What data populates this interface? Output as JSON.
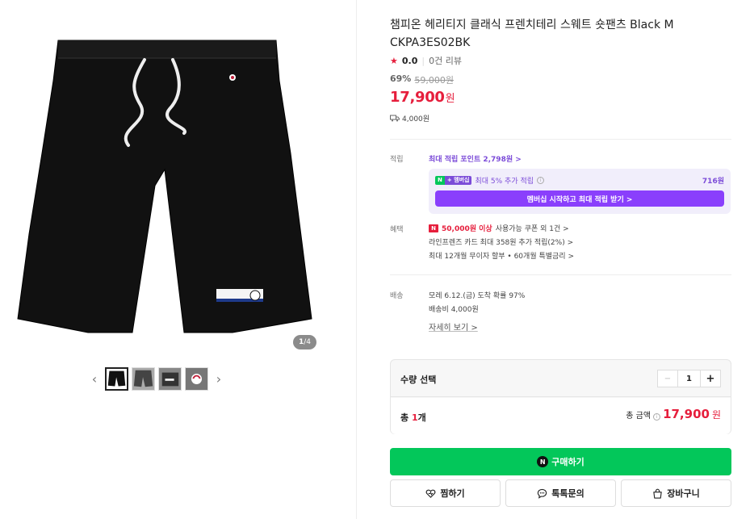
{
  "gallery": {
    "counter_current": "1",
    "counter_total": "/4",
    "prev_arrow": "‹",
    "next_arrow": "›",
    "thumbnails": [
      "thumb-1",
      "thumb-2",
      "thumb-3",
      "thumb-4"
    ]
  },
  "product": {
    "title": "챔피온 헤리티지 클래식 프렌치테리 스웨트 숏팬츠 Black M CKPA3ES02BK",
    "rating_score": "0.0",
    "review_count": "0건 리뷰",
    "discount_rate": "69%",
    "original_price": "59,000원",
    "sale_price": "17,900",
    "price_unit": "원",
    "shipping_fee": "4,000원"
  },
  "points": {
    "label": "적립",
    "max_point_link": "최대 적립 포인트 2,798원 >",
    "member_badge_n": "N",
    "member_badge_p": "+ 멤버십",
    "member_text": "최대 5% 추가 적립",
    "member_amount": "716원",
    "member_button": "멤버십 시작하고 최대 적립 받기 >"
  },
  "benefits": {
    "label": "혜택",
    "coupon_highlight": "50,000원 이상",
    "coupon_rest": "사용가능 쿠폰 외 1건 >",
    "card_text": "라인프렌즈 카드 최대 358원 추가 적립(2%) >",
    "installment_text": "최대 12개월 무이자 할부 • 60개월 특별금리 >"
  },
  "delivery": {
    "label": "배송",
    "arrival": "모레 6.12.(금) 도착 확률 97%",
    "fee": "배송비 4,000원",
    "details_link": "자세히 보기 >"
  },
  "quantity": {
    "label": "수량 선택",
    "minus": "−",
    "value": "1",
    "plus": "+",
    "total_prefix": "총 ",
    "total_count": "1",
    "total_suffix": "개",
    "total_amount_label": "총 금액",
    "total_amount": "17,900",
    "total_unit": "원"
  },
  "actions": {
    "buy_label": "구매하기",
    "buy_icon": "N",
    "wishlist_label": "찜하기",
    "talk_label": "톡톡문의",
    "cart_label": "장바구니"
  },
  "colors": {
    "accent_red": "#e61e3c",
    "naver_green": "#03c75a",
    "membership_purple": "#8a3ffc"
  }
}
